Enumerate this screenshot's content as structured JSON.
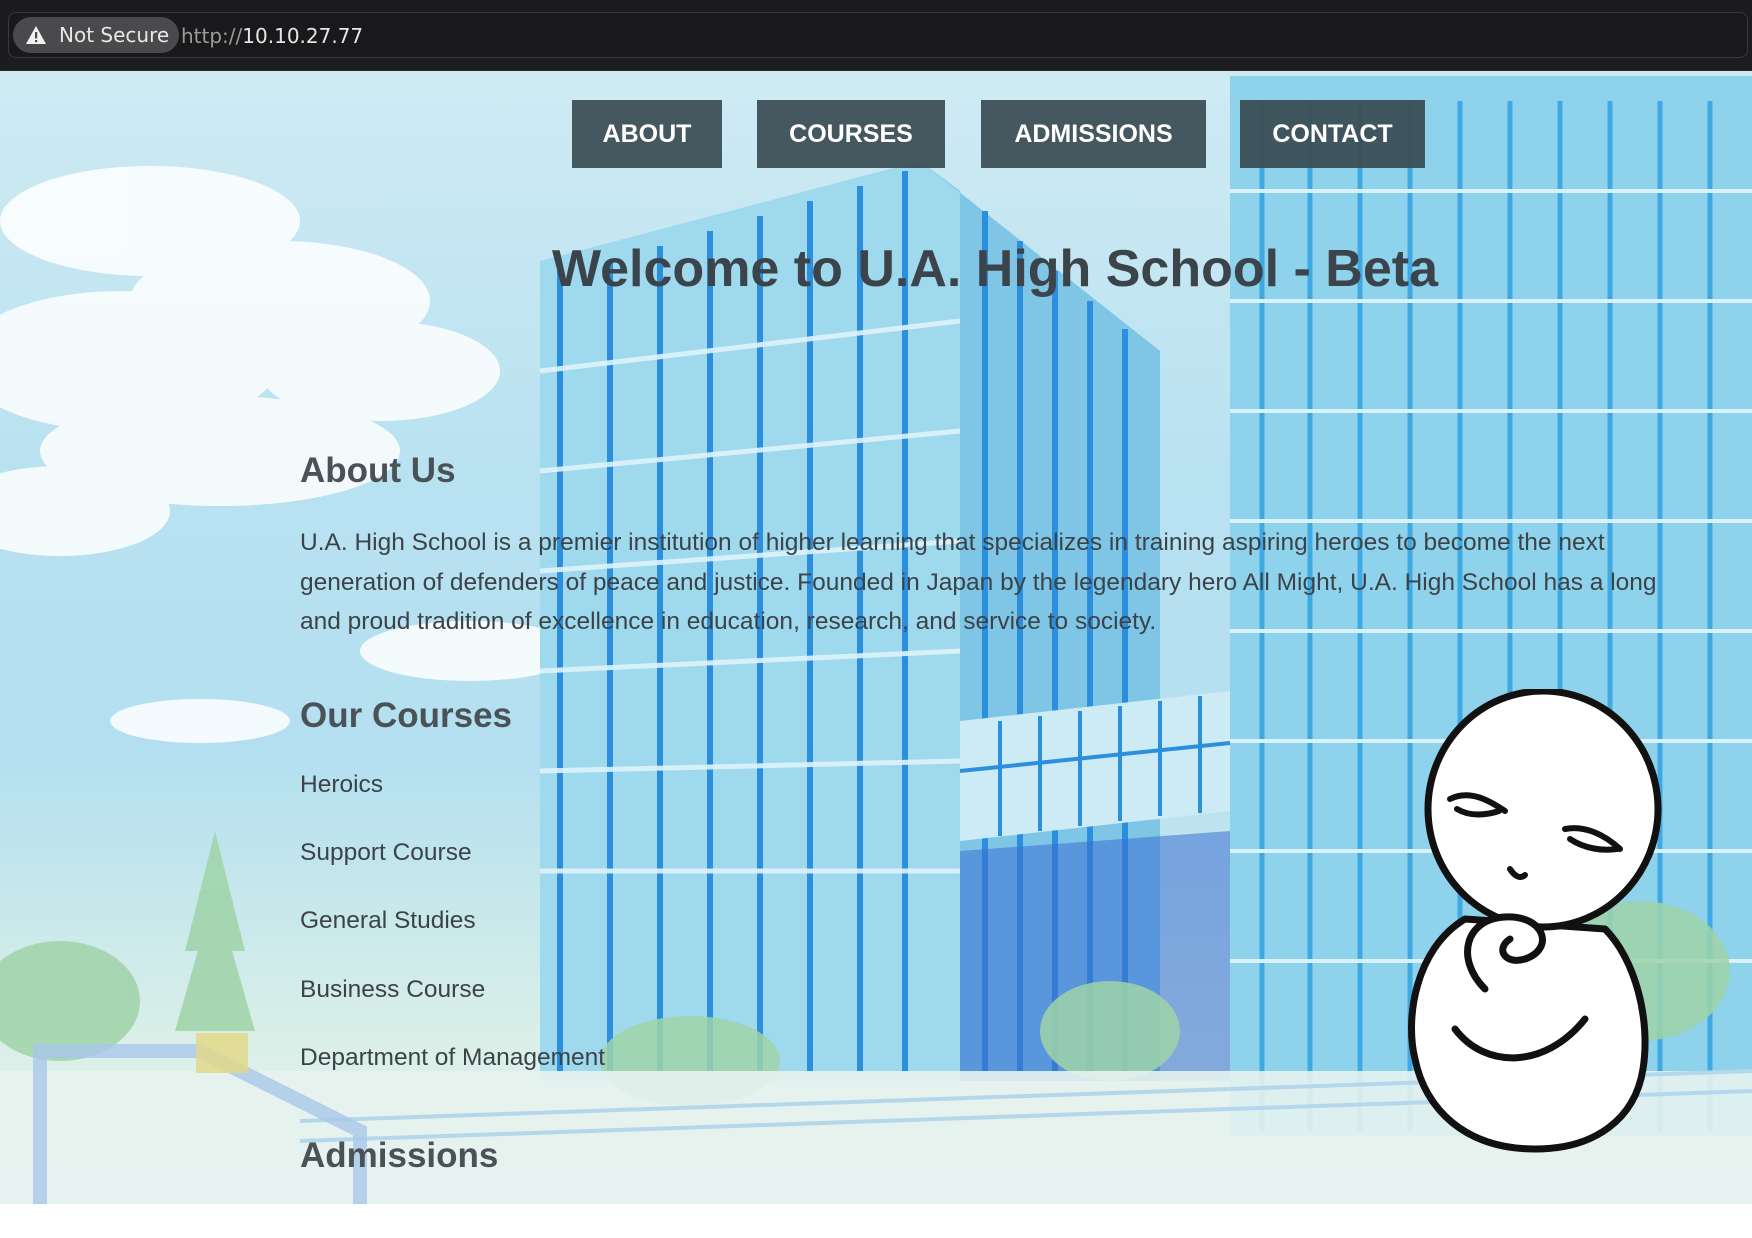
{
  "browser": {
    "security_label": "Not Secure",
    "url_scheme": "http://",
    "url_host": "10.10.27.77",
    "warning_icon": "warning-triangle-icon"
  },
  "nav": {
    "items": [
      {
        "label": "ABOUT"
      },
      {
        "label": "COURSES"
      },
      {
        "label": "ADMISSIONS"
      },
      {
        "label": "CONTACT"
      }
    ]
  },
  "page": {
    "title": "Welcome to U.A. High School - Beta"
  },
  "about": {
    "heading": "About Us",
    "text": "U.A. High School is a premier institution of higher learning that specializes in training aspiring heroes to become the next generation of defenders of peace and justice. Founded in Japan by the legendary hero All Might, U.A. High School has a long and proud tradition of excellence in education, research, and service to society."
  },
  "courses": {
    "heading": "Our Courses",
    "items": [
      "Heroics",
      "Support Course",
      "General Studies",
      "Business Course",
      "Department of Management"
    ]
  },
  "admissions": {
    "heading": "Admissions"
  }
}
